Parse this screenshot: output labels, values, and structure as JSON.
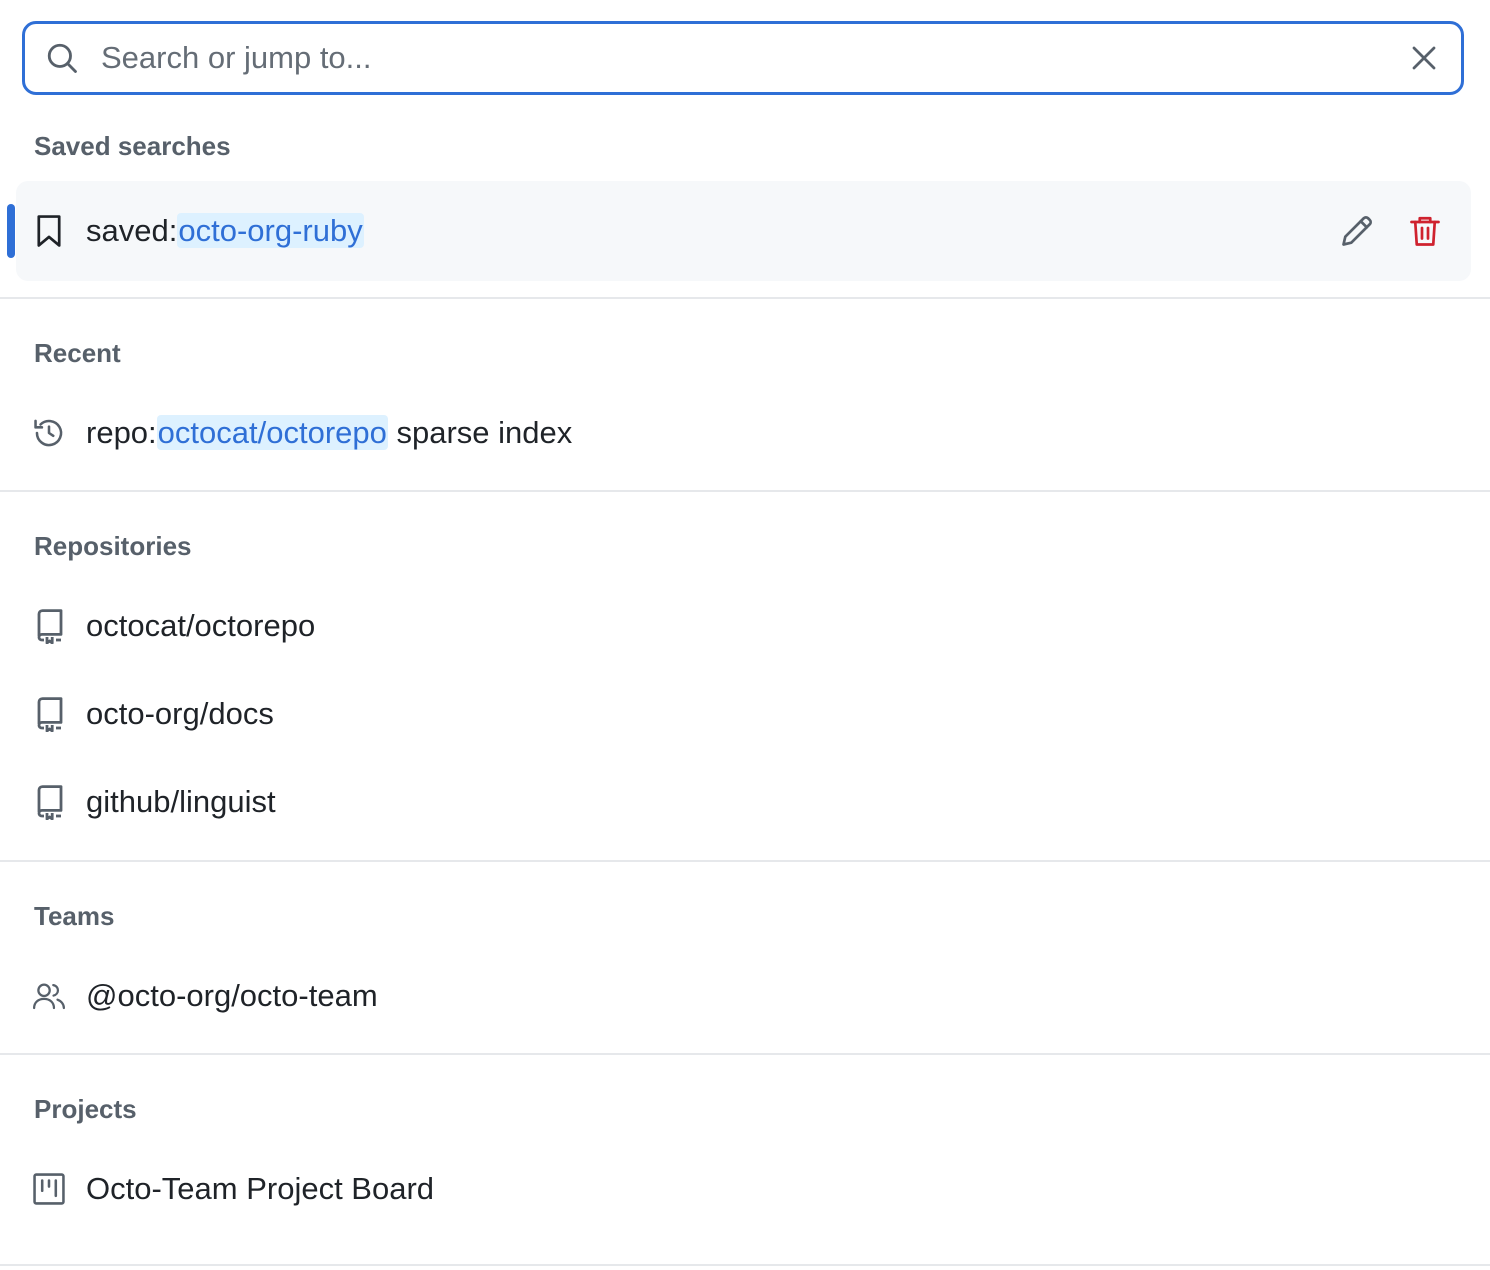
{
  "search": {
    "placeholder": "Search or jump to...",
    "value": ""
  },
  "sections": {
    "saved": {
      "title": "Saved searches",
      "item": {
        "prefix": "saved:",
        "token": "octo-org-ruby",
        "suffix": ""
      }
    },
    "recent": {
      "title": "Recent",
      "item": {
        "prefix": "repo:",
        "token": "octocat/octorepo",
        "suffix": " sparse index"
      }
    },
    "repositories": {
      "title": "Repositories",
      "items": [
        "octocat/octorepo",
        "octo-org/docs",
        "github/linguist"
      ]
    },
    "teams": {
      "title": "Teams",
      "items": [
        "@octo-org/octo-team"
      ]
    },
    "projects": {
      "title": "Projects",
      "items": [
        "Octo-Team Project Board"
      ]
    }
  },
  "colors": {
    "accent": "#2f6fd6",
    "token_bg": "#ddf1ff",
    "danger": "#cf222e",
    "muted": "#57606a"
  }
}
